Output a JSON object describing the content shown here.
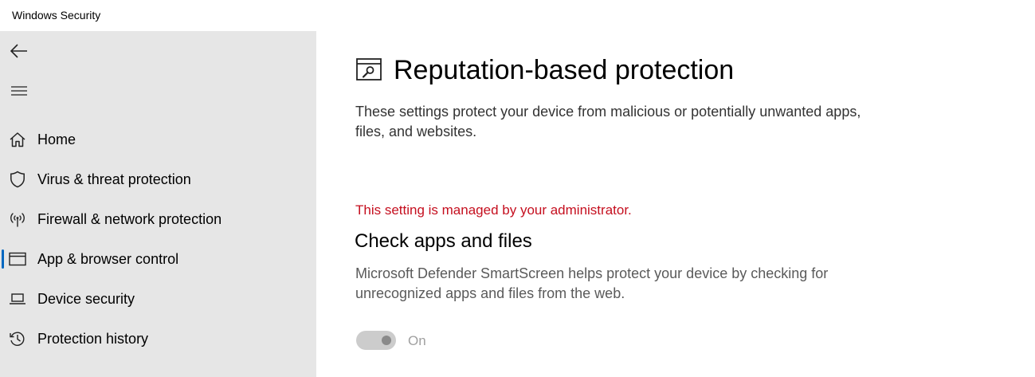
{
  "app": {
    "title": "Windows Security"
  },
  "sidebar": {
    "back_icon": "back-arrow-icon",
    "menu_icon": "hamburger-menu-icon",
    "selected": "App & browser control",
    "accent_color": "#0067c0",
    "items": [
      {
        "label": "Home",
        "icon": "home-icon"
      },
      {
        "label": "Virus & threat protection",
        "icon": "shield-icon"
      },
      {
        "label": "Firewall & network protection",
        "icon": "antenna-icon"
      },
      {
        "label": "App & browser control",
        "icon": "app-browser-icon"
      },
      {
        "label": "Device security",
        "icon": "laptop-icon"
      },
      {
        "label": "Protection history",
        "icon": "history-icon"
      }
    ]
  },
  "main": {
    "page_icon": "reputation-protection-icon",
    "title": "Reputation-based protection",
    "description": "These settings protect your device from malicious or potentially unwanted apps, files, and websites.",
    "admin_message": "This setting is managed by your administrator.",
    "admin_message_color": "#c50f1f",
    "section": {
      "title": "Check apps and files",
      "description": "Microsoft Defender SmartScreen helps protect your device by checking for unrecognized apps and files from the web.",
      "toggle_state": "on",
      "toggle_disabled": true,
      "toggle_label": "On"
    }
  }
}
